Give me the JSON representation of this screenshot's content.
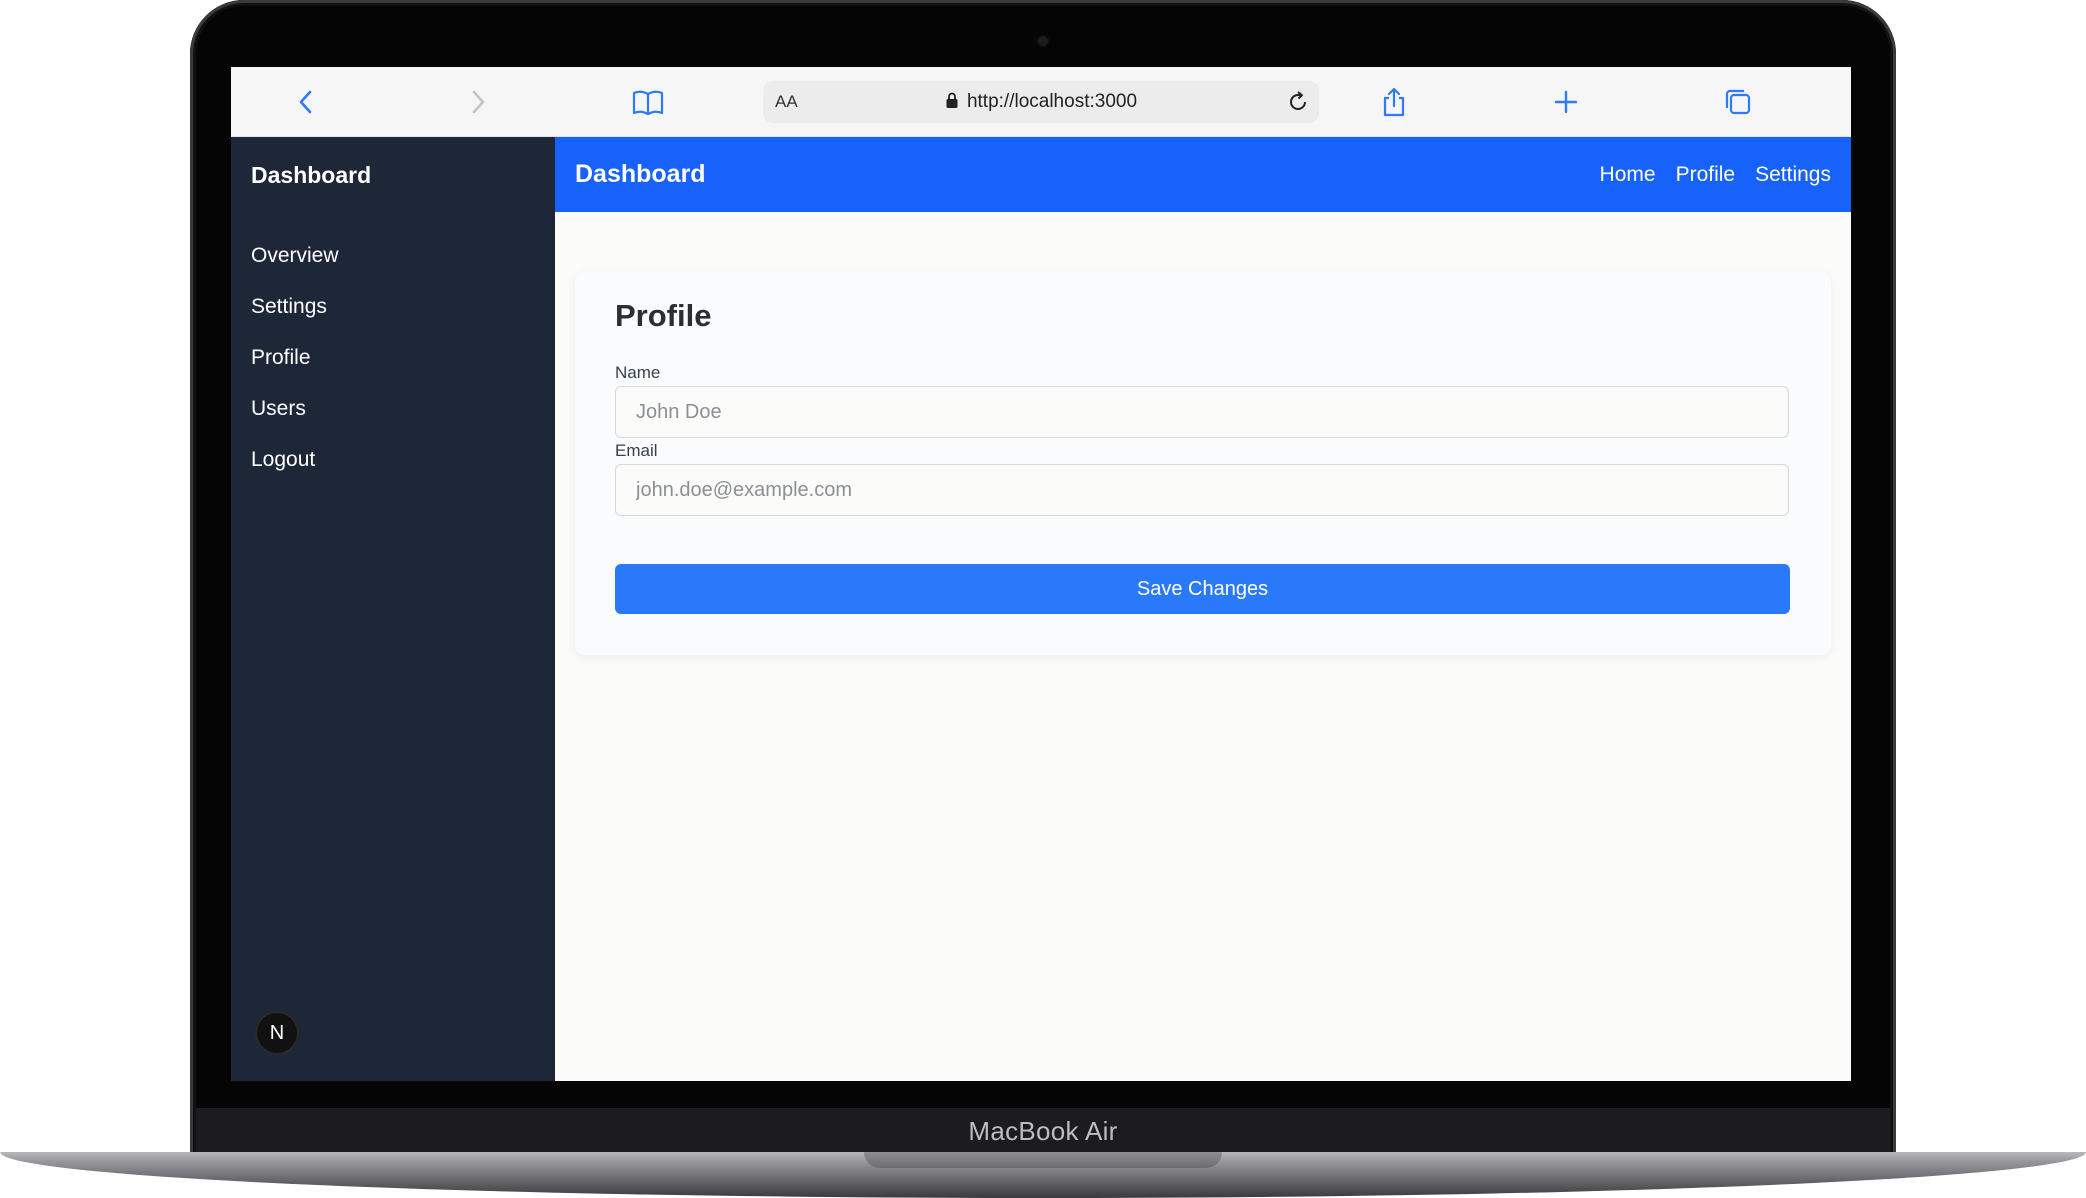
{
  "device": {
    "brand_label": "MacBook Air"
  },
  "browser": {
    "aa_label": "AA",
    "url": "http://localhost:3000"
  },
  "sidebar": {
    "title": "Dashboard",
    "items": [
      {
        "label": "Overview"
      },
      {
        "label": "Settings"
      },
      {
        "label": "Profile"
      },
      {
        "label": "Users"
      },
      {
        "label": "Logout"
      }
    ],
    "badge": "N"
  },
  "topbar": {
    "title": "Dashboard",
    "links": [
      {
        "label": "Home"
      },
      {
        "label": "Profile"
      },
      {
        "label": "Settings"
      }
    ]
  },
  "profile_form": {
    "title": "Profile",
    "name_label": "Name",
    "name_placeholder": "John Doe",
    "email_label": "Email",
    "email_placeholder": "john.doe@example.com",
    "save_label": "Save Changes"
  },
  "icons": {
    "back": "chevron-left-icon",
    "forward": "chevron-right-icon",
    "reader": "book-icon",
    "lock": "lock-icon",
    "reload": "reload-icon",
    "share": "share-icon",
    "new_tab": "plus-icon",
    "tabs": "tabs-icon"
  },
  "colors": {
    "topbar": "#1762fb",
    "sidebar": "#1d2738",
    "button": "#2a79fa",
    "toolbar_icon": "#2f7bf6"
  }
}
